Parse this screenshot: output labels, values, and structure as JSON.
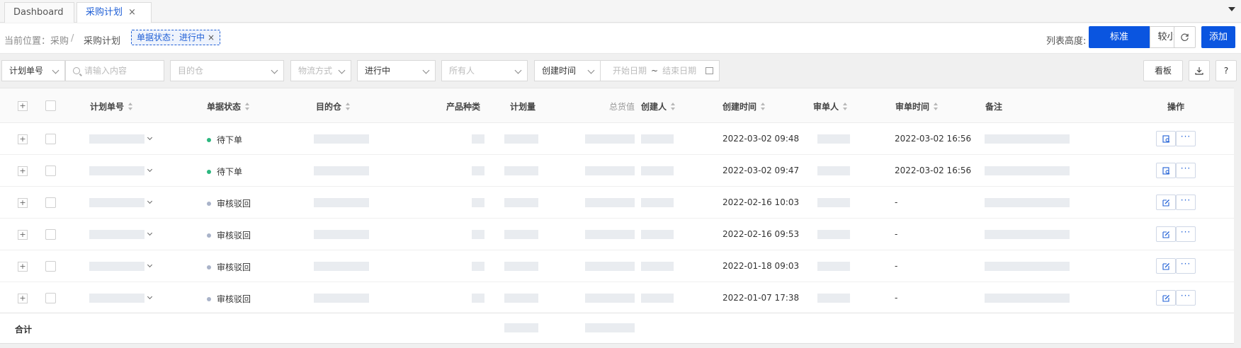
{
  "tabs": [
    {
      "label": "Dashboard",
      "active": false
    },
    {
      "label": "采购计划",
      "active": true
    }
  ],
  "breadcrumb": {
    "prefix": "当前位置：采购",
    "separator": "/",
    "current": "采购计划"
  },
  "filter_chip": {
    "label": "单据状态：进行中",
    "close": "×"
  },
  "header_actions": {
    "height_label": "列表高度:",
    "standard": "标准",
    "compact": "较小",
    "add": "添加"
  },
  "toolbar": {
    "field_select": "计划单号",
    "search_placeholder": "请输入内容",
    "warehouse_placeholder": "目的仓",
    "logistics_placeholder": "物流方式",
    "status_value": "进行中",
    "owner_placeholder": "所有人",
    "date_type": "创建时间",
    "start_date": "开始日期",
    "tilde": "~",
    "end_date": "结束日期",
    "board": "看板",
    "help": "?"
  },
  "table": {
    "columns": {
      "plan_no": "计划单号",
      "status": "单据状态",
      "warehouse": "目的仓",
      "product_types": "产品种类",
      "plan_qty": "计划量",
      "total_value": "总货值",
      "creator": "创建人",
      "created_at": "创建时间",
      "reviewer": "审单人",
      "reviewed_at": "审单时间",
      "remark": "备注",
      "actions": "操作"
    },
    "rows": [
      {
        "status": "待下单",
        "status_color": "#2cb77f",
        "created_at": "2022-03-02 09:48",
        "reviewed_at": "2022-03-02 16:56",
        "action_icon": "review-icon"
      },
      {
        "status": "待下单",
        "status_color": "#2cb77f",
        "created_at": "2022-03-02 09:47",
        "reviewed_at": "2022-03-02 16:56",
        "action_icon": "review-icon"
      },
      {
        "status": "审核驳回",
        "status_color": "#a9b3c9",
        "created_at": "2022-02-16 10:03",
        "reviewed_at": "-",
        "action_icon": "edit-icon"
      },
      {
        "status": "审核驳回",
        "status_color": "#a9b3c9",
        "created_at": "2022-02-16 09:53",
        "reviewed_at": "-",
        "action_icon": "edit-icon"
      },
      {
        "status": "审核驳回",
        "status_color": "#a9b3c9",
        "created_at": "2022-01-18 09:03",
        "reviewed_at": "-",
        "action_icon": "edit-icon"
      },
      {
        "status": "审核驳回",
        "status_color": "#a9b3c9",
        "created_at": "2022-01-07 17:38",
        "reviewed_at": "-",
        "action_icon": "edit-icon"
      }
    ],
    "total_label": "合计",
    "more_label": "···"
  },
  "colors": {
    "primary": "#0a55e0",
    "accent_text": "#1f5fd6"
  }
}
